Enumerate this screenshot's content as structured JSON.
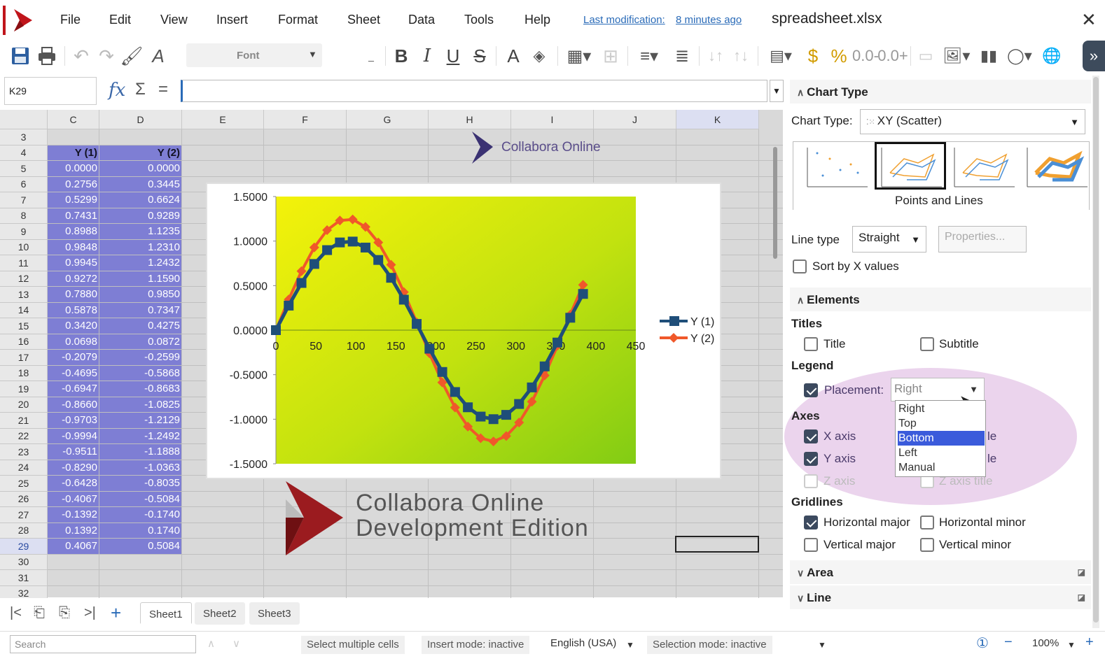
{
  "menubar": {
    "items": [
      "File",
      "Edit",
      "View",
      "Insert",
      "Format",
      "Sheet",
      "Data",
      "Tools",
      "Help"
    ],
    "last_mod_label": "Last modification:",
    "last_mod_value": "8 minutes ago",
    "document_name": "spreadsheet.xlsx"
  },
  "toolbar": {
    "font_placeholder": "Font"
  },
  "formula_bar": {
    "name_box": "K29",
    "formula": ""
  },
  "grid": {
    "columns": [
      "C",
      "D",
      "E",
      "F",
      "G",
      "H",
      "I",
      "J",
      "K"
    ],
    "row_numbers": [
      "3",
      "4",
      "5",
      "6",
      "7",
      "8",
      "9",
      "10",
      "11",
      "12",
      "13",
      "14",
      "15",
      "16",
      "17",
      "18",
      "19",
      "20",
      "21",
      "22",
      "23",
      "24",
      "25",
      "26",
      "27",
      "28",
      "29",
      "30",
      "31",
      "32"
    ],
    "header_c": "Y (1)",
    "header_d": "Y (2)",
    "col_c": [
      "0.0000",
      "0.2756",
      "0.5299",
      "0.7431",
      "0.8988",
      "0.9848",
      "0.9945",
      "0.9272",
      "0.7880",
      "0.5878",
      "0.3420",
      "0.0698",
      "-0.2079",
      "-0.4695",
      "-0.6947",
      "-0.8660",
      "-0.9703",
      "-0.9994",
      "-0.9511",
      "-0.8290",
      "-0.6428",
      "-0.4067",
      "-0.1392",
      "0.1392",
      "0.4067"
    ],
    "col_d": [
      "0.0000",
      "0.3445",
      "0.6624",
      "0.9289",
      "1.1235",
      "1.2310",
      "1.2432",
      "1.1590",
      "0.9850",
      "0.7347",
      "0.4275",
      "0.0872",
      "-0.2599",
      "-0.5868",
      "-0.8683",
      "-1.0825",
      "-1.2129",
      "-1.2492",
      "-1.1888",
      "-1.0363",
      "-0.8035",
      "-0.5084",
      "-0.1740",
      "0.1740",
      "0.5084"
    ]
  },
  "chart_data": {
    "type": "scatter",
    "x": [
      0,
      16,
      32,
      48,
      64,
      80,
      96,
      112,
      128,
      144,
      160,
      176,
      192,
      208,
      224,
      240,
      256,
      272,
      288,
      304,
      320,
      336,
      352,
      368,
      384
    ],
    "series": [
      {
        "name": "Y (1)",
        "color": "#1f4e79",
        "values": [
          0.0,
          0.2756,
          0.5299,
          0.7431,
          0.8988,
          0.9848,
          0.9945,
          0.9272,
          0.788,
          0.5878,
          0.342,
          0.0698,
          -0.2079,
          -0.4695,
          -0.6947,
          -0.866,
          -0.9703,
          -0.9994,
          -0.9511,
          -0.829,
          -0.6428,
          -0.4067,
          -0.1392,
          0.1392,
          0.4067
        ]
      },
      {
        "name": "Y (2)",
        "color": "#f0582a",
        "values": [
          0.0,
          0.3445,
          0.6624,
          0.9289,
          1.1235,
          1.231,
          1.2432,
          1.159,
          0.985,
          0.7347,
          0.4275,
          0.0872,
          -0.2599,
          -0.5868,
          -0.8683,
          -1.0825,
          -1.2129,
          -1.2492,
          -1.1888,
          -1.0363,
          -0.8035,
          -0.5084,
          -0.174,
          0.174,
          0.5084
        ]
      }
    ],
    "x_ticks": [
      "0",
      "50",
      "100",
      "150",
      "200",
      "250",
      "300",
      "350",
      "400",
      "450"
    ],
    "y_ticks": [
      "1.5000",
      "1.0000",
      "0.5000",
      "0.0000",
      "-0.5000",
      "-1.0000",
      "-1.5000"
    ],
    "xlim": [
      0,
      450
    ],
    "ylim": [
      -1.5,
      1.5
    ],
    "legend_placement": "right"
  },
  "watermark": {
    "top_text": "Collabora Online",
    "line1": "Collabora Online",
    "line2": "Development Edition"
  },
  "sheet_tabs": [
    "Sheet1",
    "Sheet2",
    "Sheet3"
  ],
  "status": {
    "search_placeholder": "Search",
    "select_multiple": "Select multiple cells",
    "insert_mode": "Insert mode: inactive",
    "language": "English (USA)",
    "selection_mode": "Selection mode: inactive",
    "zoom": "100%"
  },
  "sidebar": {
    "chart_type_header": "Chart Type",
    "chart_type_label": "Chart Type:",
    "chart_type_value": "XY (Scatter)",
    "variant_label": "Points and Lines",
    "line_type_label": "Line type",
    "line_type_value": "Straight",
    "properties_button": "Properties...",
    "sort_label": "Sort by X values",
    "elements_header": "Elements",
    "titles_label": "Titles",
    "title_label": "Title",
    "subtitle_label": "Subtitle",
    "legend_label": "Legend",
    "placement_label": "Placement:",
    "placement_value": "Right",
    "placement_options": [
      "Right",
      "Top",
      "Bottom",
      "Left",
      "Manual"
    ],
    "axes_label": "Axes",
    "x_axis": "X axis",
    "y_axis": "Y axis",
    "z_axis": "Z axis",
    "title_suffix_x": "le",
    "title_suffix_y": "le",
    "z_axis_title": "Z axis title",
    "gridlines_label": "Gridlines",
    "h_major": "Horizontal major",
    "h_minor": "Horizontal minor",
    "v_major": "Vertical major",
    "v_minor": "Vertical minor",
    "area_header": "Area",
    "line_header": "Line"
  }
}
